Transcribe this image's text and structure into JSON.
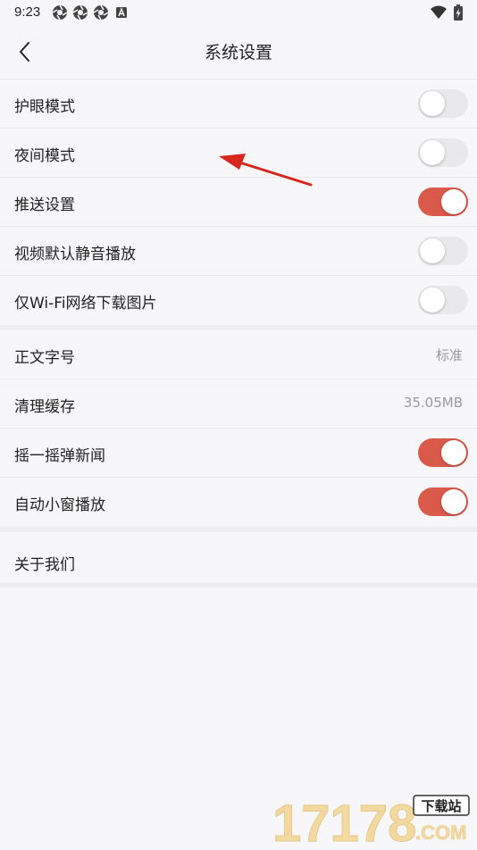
{
  "status_bar": {
    "time": "9:23",
    "notification_icons": [
      "aperture-icon",
      "aperture-icon",
      "aperture-icon",
      "a-box-icon"
    ],
    "right_icons": [
      "wifi-icon",
      "battery-charging-icon"
    ]
  },
  "header": {
    "title": "系统设置",
    "back_icon": "chevron-left-icon"
  },
  "settings": {
    "eye_care": {
      "label": "护眼模式",
      "enabled": false
    },
    "night_mode": {
      "label": "夜间模式",
      "enabled": false
    },
    "push": {
      "label": "推送设置",
      "enabled": true
    },
    "video_mute": {
      "label": "视频默认静音播放",
      "enabled": false
    },
    "wifi_only_images": {
      "label": "仅Wi-Fi网络下载图片",
      "enabled": false
    },
    "font_size": {
      "label": "正文字号",
      "value": "标准"
    },
    "clear_cache": {
      "label": "清理缓存",
      "value": "35.05MB"
    },
    "shake_news": {
      "label": "摇一摇弹新闻",
      "enabled": true
    },
    "auto_mini_window": {
      "label": "自动小窗播放",
      "enabled": true
    },
    "about": {
      "label": "关于我们"
    }
  },
  "annotation": {
    "arrow_color": "#d8271f"
  },
  "watermark": {
    "main": "17178",
    "badge": "下载站",
    "sub": ".COM"
  },
  "colors": {
    "toggle_on": "#d9594a",
    "toggle_off": "#e9e9ec",
    "background": "#f7f7f9"
  }
}
